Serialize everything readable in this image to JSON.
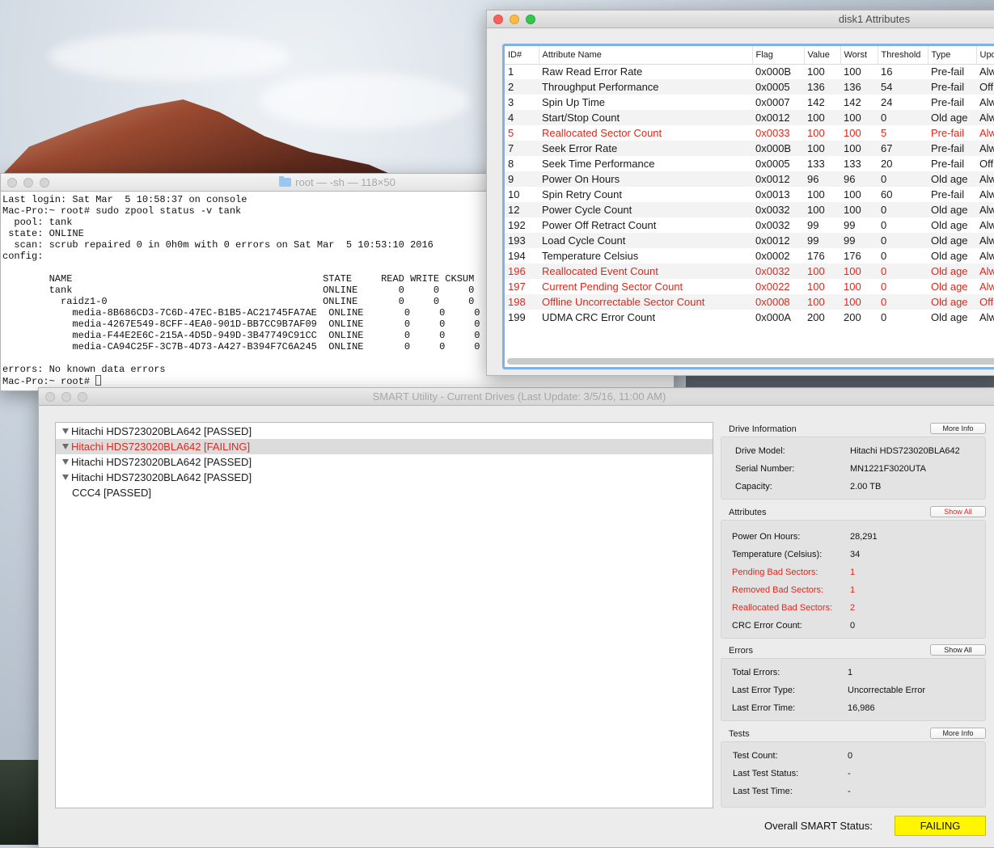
{
  "terminal": {
    "title": "root — -sh — 118×50",
    "lines": [
      "Last login: Sat Mar  5 10:58:37 on console",
      "Mac-Pro:~ root# sudo zpool status -v tank",
      "  pool: tank",
      " state: ONLINE",
      "  scan: scrub repaired 0 in 0h0m with 0 errors on Sat Mar  5 10:53:10 2016",
      "config:",
      "",
      "        NAME                                           STATE     READ WRITE CKSUM",
      "        tank                                           ONLINE       0     0     0",
      "          raidz1-0                                     ONLINE       0     0     0",
      "            media-8B686CD3-7C6D-47EC-B1B5-AC21745FA7AE  ONLINE       0     0     0",
      "            media-4267E549-8CFF-4EA0-901D-BB7CC9B7AF09  ONLINE       0     0     0",
      "            media-F44E2E6C-215A-4D5D-949D-3B47749C91CC  ONLINE       0     0     0",
      "            media-CA94C25F-3C7B-4D73-A427-B394F7C6A245  ONLINE       0     0     0",
      "",
      "errors: No known data errors"
    ],
    "prompt": "Mac-Pro:~ root# "
  },
  "attributes_window": {
    "title": "disk1 Attributes",
    "columns": [
      "ID#",
      "Attribute Name",
      "Flag",
      "Value",
      "Worst",
      "Threshold",
      "Type",
      "Upd"
    ],
    "rows": [
      {
        "id": "1",
        "name": "Raw Read Error Rate",
        "flag": "0x000B",
        "value": "100",
        "worst": "100",
        "threshold": "16",
        "type": "Pre-fail",
        "upd": "Alw",
        "bad": false
      },
      {
        "id": "2",
        "name": "Throughput Performance",
        "flag": "0x0005",
        "value": "136",
        "worst": "136",
        "threshold": "54",
        "type": "Pre-fail",
        "upd": "Off",
        "bad": false
      },
      {
        "id": "3",
        "name": "Spin Up Time",
        "flag": "0x0007",
        "value": "142",
        "worst": "142",
        "threshold": "24",
        "type": "Pre-fail",
        "upd": "Alw",
        "bad": false
      },
      {
        "id": "4",
        "name": "Start/Stop Count",
        "flag": "0x0012",
        "value": "100",
        "worst": "100",
        "threshold": "0",
        "type": "Old age",
        "upd": "Alw",
        "bad": false
      },
      {
        "id": "5",
        "name": "Reallocated Sector Count",
        "flag": "0x0033",
        "value": "100",
        "worst": "100",
        "threshold": "5",
        "type": "Pre-fail",
        "upd": "Alw",
        "bad": true
      },
      {
        "id": "7",
        "name": "Seek Error Rate",
        "flag": "0x000B",
        "value": "100",
        "worst": "100",
        "threshold": "67",
        "type": "Pre-fail",
        "upd": "Alw",
        "bad": false
      },
      {
        "id": "8",
        "name": "Seek Time Performance",
        "flag": "0x0005",
        "value": "133",
        "worst": "133",
        "threshold": "20",
        "type": "Pre-fail",
        "upd": "Off",
        "bad": false
      },
      {
        "id": "9",
        "name": "Power On Hours",
        "flag": "0x0012",
        "value": "96",
        "worst": "96",
        "threshold": "0",
        "type": "Old age",
        "upd": "Alw",
        "bad": false
      },
      {
        "id": "10",
        "name": "Spin Retry Count",
        "flag": "0x0013",
        "value": "100",
        "worst": "100",
        "threshold": "60",
        "type": "Pre-fail",
        "upd": "Alw",
        "bad": false
      },
      {
        "id": "12",
        "name": "Power Cycle Count",
        "flag": "0x0032",
        "value": "100",
        "worst": "100",
        "threshold": "0",
        "type": "Old age",
        "upd": "Alw",
        "bad": false
      },
      {
        "id": "192",
        "name": "Power Off Retract Count",
        "flag": "0x0032",
        "value": "99",
        "worst": "99",
        "threshold": "0",
        "type": "Old age",
        "upd": "Alw",
        "bad": false
      },
      {
        "id": "193",
        "name": "Load Cycle Count",
        "flag": "0x0012",
        "value": "99",
        "worst": "99",
        "threshold": "0",
        "type": "Old age",
        "upd": "Alw",
        "bad": false
      },
      {
        "id": "194",
        "name": "Temperature Celsius",
        "flag": "0x0002",
        "value": "176",
        "worst": "176",
        "threshold": "0",
        "type": "Old age",
        "upd": "Alw",
        "bad": false
      },
      {
        "id": "196",
        "name": "Reallocated Event Count",
        "flag": "0x0032",
        "value": "100",
        "worst": "100",
        "threshold": "0",
        "type": "Old age",
        "upd": "Alw",
        "bad": true
      },
      {
        "id": "197",
        "name": "Current Pending Sector Count",
        "flag": "0x0022",
        "value": "100",
        "worst": "100",
        "threshold": "0",
        "type": "Old age",
        "upd": "Alw",
        "bad": true
      },
      {
        "id": "198",
        "name": "Offline Uncorrectable Sector Count",
        "flag": "0x0008",
        "value": "100",
        "worst": "100",
        "threshold": "0",
        "type": "Old age",
        "upd": "Off",
        "bad": true
      },
      {
        "id": "199",
        "name": "UDMA CRC Error Count",
        "flag": "0x000A",
        "value": "200",
        "worst": "200",
        "threshold": "0",
        "type": "Old age",
        "upd": "Alw",
        "bad": false
      }
    ]
  },
  "smart_window": {
    "title": "SMART Utility - Current Drives (Last Update: 3/5/16, 11:00 AM)",
    "drives": [
      {
        "label": "Hitachi HDS723020BLA642  [PASSED]",
        "failing": false,
        "selected": false,
        "child": false
      },
      {
        "label": "Hitachi HDS723020BLA642  [FAILING]",
        "failing": true,
        "selected": true,
        "child": false
      },
      {
        "label": "Hitachi HDS723020BLA642  [PASSED]",
        "failing": false,
        "selected": false,
        "child": false
      },
      {
        "label": "Hitachi HDS723020BLA642  [PASSED]",
        "failing": false,
        "selected": false,
        "child": false
      },
      {
        "label": "CCC4  [PASSED]",
        "failing": false,
        "selected": false,
        "child": true
      }
    ],
    "drive_info": {
      "heading": "Drive Information",
      "button": "More Info",
      "model_label": "Drive Model:",
      "model_value": "Hitachi HDS723020BLA642",
      "serial_label": "Serial Number:",
      "serial_value": "MN1221F3020UTA",
      "capacity_label": "Capacity:",
      "capacity_value": "2.00 TB"
    },
    "attributes": {
      "heading": "Attributes",
      "button": "Show All",
      "items": [
        {
          "label": "Power On Hours:",
          "value": "28,291",
          "red": false
        },
        {
          "label": "Temperature (Celsius):",
          "value": "34",
          "red": false
        },
        {
          "label": "Pending Bad Sectors:",
          "value": "1",
          "red": true
        },
        {
          "label": "Removed Bad Sectors:",
          "value": "1",
          "red": true
        },
        {
          "label": "Reallocated Bad Sectors:",
          "value": "2",
          "red": true
        },
        {
          "label": "CRC Error Count:",
          "value": "0",
          "red": false
        }
      ]
    },
    "errors": {
      "heading": "Errors",
      "button": "Show All",
      "items": [
        {
          "label": "Total Errors:",
          "value": "1"
        },
        {
          "label": "Last Error Type:",
          "value": "Uncorrectable Error"
        },
        {
          "label": "Last Error Time:",
          "value": "16,986"
        }
      ]
    },
    "tests": {
      "heading": "Tests",
      "button": "More Info",
      "items": [
        {
          "label": "Test Count:",
          "value": "0"
        },
        {
          "label": "Last Test Status:",
          "value": "-"
        },
        {
          "label": "Last Test Time:",
          "value": "-"
        }
      ]
    },
    "overall_label": "Overall SMART Status:",
    "overall_value": "FAILING",
    "overall_color": "#fff600"
  },
  "colors": {
    "failing_red": "#e1271b",
    "selection_blue": "#7fb0ea"
  }
}
